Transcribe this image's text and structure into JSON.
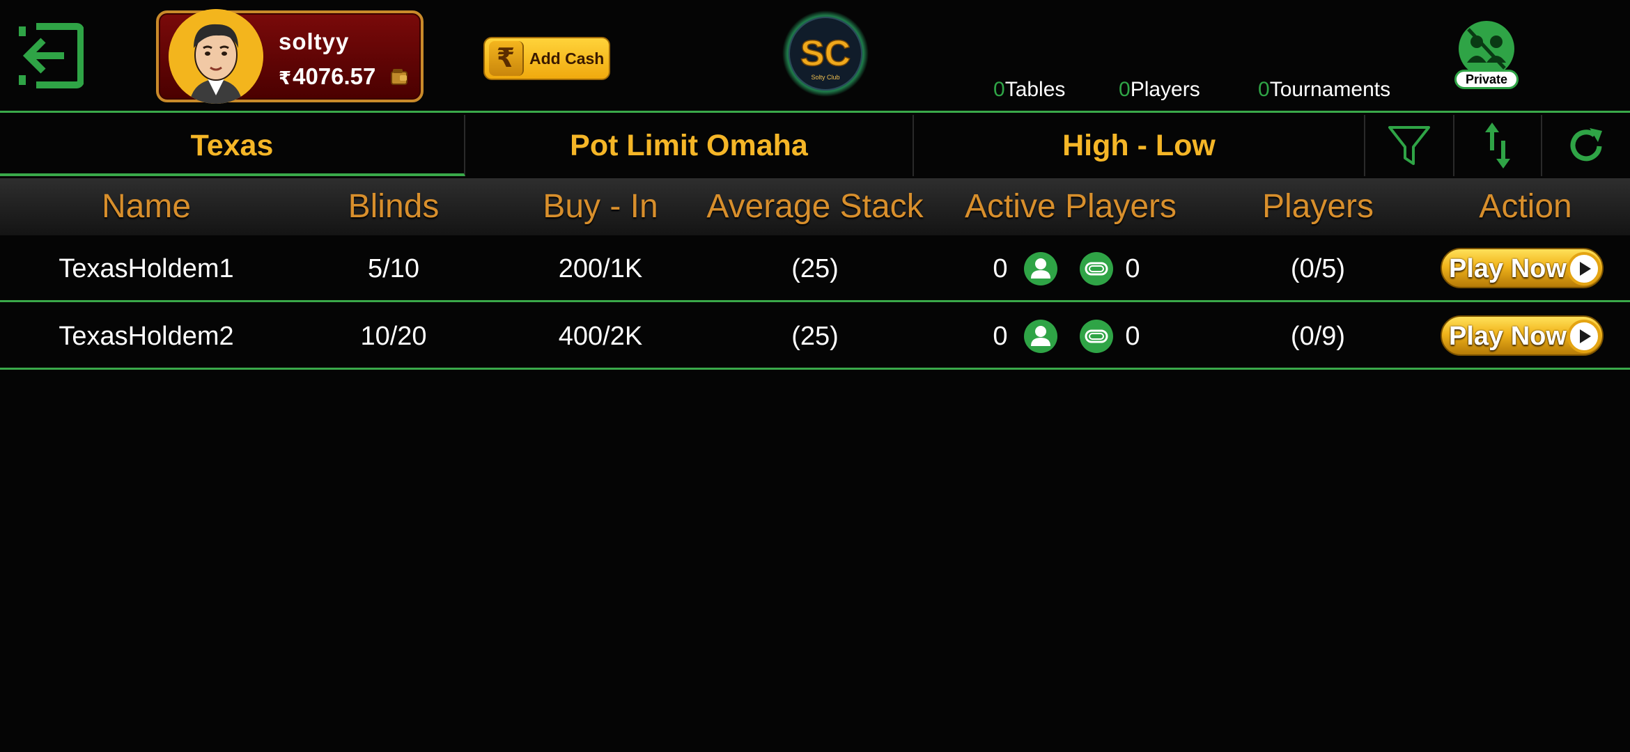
{
  "profile": {
    "username": "soltyy",
    "currency_symbol": "₹",
    "balance": "4076.57"
  },
  "add_cash": {
    "symbol": "₹",
    "label": "Add Cash"
  },
  "logo": {
    "text": "SC",
    "subtext": "Solty Club"
  },
  "stats": [
    {
      "count": "0",
      "label": "Tables"
    },
    {
      "count": "0",
      "label": "Players"
    },
    {
      "count": "0",
      "label": "Tournaments"
    }
  ],
  "private_label": "Private",
  "tabs": [
    "Texas",
    "Pot Limit Omaha",
    "High - Low"
  ],
  "active_tab": "Texas",
  "columns": [
    "Name",
    "Blinds",
    "Buy - In",
    "Average Stack",
    "Active Players",
    "Players",
    "Action"
  ],
  "rows": [
    {
      "name": "TexasHoldem1",
      "blinds": "5/10",
      "buy_in": "200/1K",
      "avg_stack": "(25)",
      "active_players": "0",
      "active_tables": "0",
      "players": "(0/5)",
      "action": "Play Now"
    },
    {
      "name": "TexasHoldem2",
      "blinds": "10/20",
      "buy_in": "400/2K",
      "avg_stack": "(25)",
      "active_players": "0",
      "active_tables": "0",
      "players": "(0/9)",
      "action": "Play Now"
    }
  ],
  "colors": {
    "accent_green": "#3aa94a",
    "tab_gold": "#f5b627",
    "header_orange": "#d88f2c",
    "card_red": "#6a0606",
    "button_gold": "#f1b41b"
  },
  "icons": [
    "exit-icon",
    "wallet-icon",
    "rupee-icon",
    "filter-icon",
    "sort-icon",
    "refresh-icon",
    "user-icon",
    "table-icon",
    "play-icon",
    "private-table-icon"
  ]
}
